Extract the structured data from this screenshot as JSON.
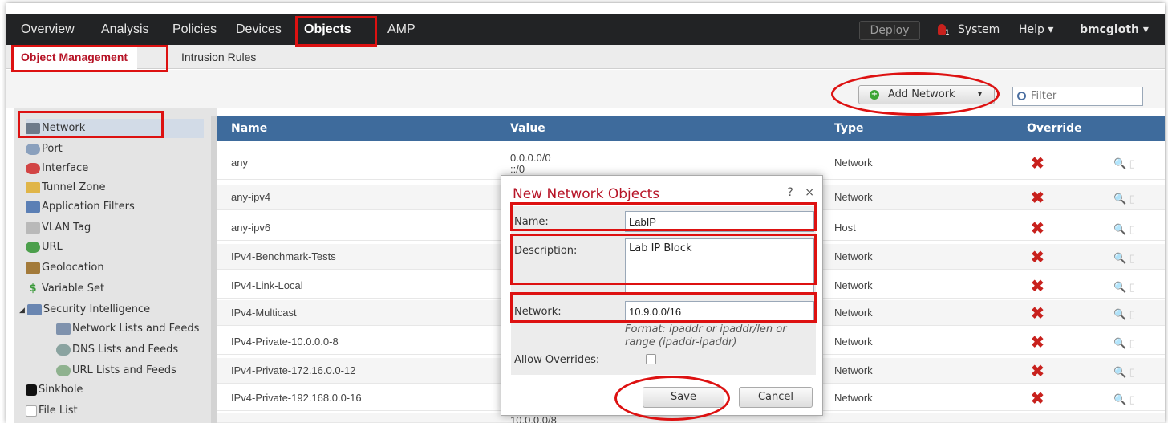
{
  "topnav": {
    "items": [
      "Overview",
      "Analysis",
      "Policies",
      "Devices",
      "Objects",
      "AMP"
    ],
    "deploy_label": "Deploy",
    "alert_count": "1",
    "system_label": "System",
    "help_label": "Help ▾",
    "user_label": "bmcgloth ▾"
  },
  "subnav": {
    "items": [
      "Object Management",
      "Intrusion Rules"
    ]
  },
  "toolbar": {
    "add_label": "Add Network",
    "add_caret": "▾",
    "filter_placeholder": "Filter"
  },
  "sidebar": {
    "items": [
      {
        "label": "Network",
        "icon": "network-icon"
      },
      {
        "label": "Port",
        "icon": "port-icon"
      },
      {
        "label": "Interface",
        "icon": "interface-icon"
      },
      {
        "label": "Tunnel Zone",
        "icon": "tunnel-zone-icon"
      },
      {
        "label": "Application Filters",
        "icon": "application-filters-icon"
      },
      {
        "label": "VLAN Tag",
        "icon": "vlan-tag-icon"
      },
      {
        "label": "URL",
        "icon": "url-icon"
      },
      {
        "label": "Geolocation",
        "icon": "geolocation-icon"
      },
      {
        "label": "Variable Set",
        "icon": "variable-set-icon"
      },
      {
        "label": "Security Intelligence",
        "icon": "security-intelligence-icon"
      },
      {
        "label": "Network Lists and Feeds",
        "icon": "network-lists-icon"
      },
      {
        "label": "DNS Lists and Feeds",
        "icon": "dns-lists-icon"
      },
      {
        "label": "URL Lists and Feeds",
        "icon": "url-lists-icon"
      },
      {
        "label": "Sinkhole",
        "icon": "sinkhole-icon"
      },
      {
        "label": "File List",
        "icon": "file-list-icon"
      }
    ]
  },
  "table": {
    "headers": [
      "Name",
      "Value",
      "Type",
      "Override"
    ],
    "rows": [
      {
        "name": "any",
        "value": "0.0.0.0/0",
        "value2": "::/0",
        "type": "Network"
      },
      {
        "name": "any-ipv4",
        "value": "",
        "value2": "",
        "type": "Network"
      },
      {
        "name": "any-ipv6",
        "value": "",
        "value2": "",
        "type": "Host"
      },
      {
        "name": "IPv4-Benchmark-Tests",
        "value": "",
        "value2": "",
        "type": "Network"
      },
      {
        "name": "IPv4-Link-Local",
        "value": "",
        "value2": "",
        "type": "Network"
      },
      {
        "name": "IPv4-Multicast",
        "value": "",
        "value2": "",
        "type": "Network"
      },
      {
        "name": "IPv4-Private-10.0.0.0-8",
        "value": "",
        "value2": "",
        "type": "Network"
      },
      {
        "name": "IPv4-Private-172.16.0.0-12",
        "value": "",
        "value2": "",
        "type": "Network"
      },
      {
        "name": "IPv4-Private-192.168.0.0-16",
        "value": "",
        "value2": "",
        "type": "Network"
      },
      {
        "name": "",
        "value": "10.0.0.0/8",
        "value2": "",
        "type": ""
      }
    ],
    "override_mark": "✖"
  },
  "modal": {
    "title": "New Network Objects",
    "help": "?",
    "close": "×",
    "name_label": "Name:",
    "name_value": "LabIP",
    "description_label": "Description:",
    "description_value": "Lab IP Block",
    "network_label": "Network:",
    "network_value": "10.9.0.0/16",
    "format_hint": "Format: ipaddr or ipaddr/len or range (ipaddr-ipaddr)",
    "allow_overrides_label": "Allow Overrides:",
    "save_label": "Save",
    "cancel_label": "Cancel"
  },
  "colors": {
    "accent_red": "#b71427",
    "annotation_red": "#dd1111",
    "table_header": "#3e6b9c"
  }
}
